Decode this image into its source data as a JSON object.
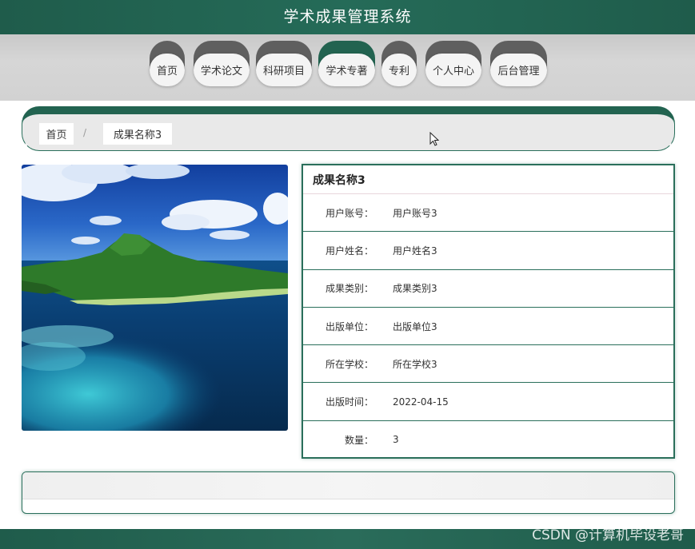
{
  "header": {
    "title": "学术成果管理系统"
  },
  "nav": {
    "items": [
      {
        "label": "首页"
      },
      {
        "label": "学术论文"
      },
      {
        "label": "科研项目"
      },
      {
        "label": "学术专著",
        "active": true
      },
      {
        "label": "专利"
      },
      {
        "label": "个人中心"
      },
      {
        "label": "后台管理"
      }
    ]
  },
  "breadcrumb": {
    "home": "首页",
    "separator": "/",
    "current": "成果名称3"
  },
  "detail": {
    "title": "成果名称3",
    "fields": [
      {
        "label": "用户账号：",
        "value": "用户账号3"
      },
      {
        "label": "用户姓名：",
        "value": "用户姓名3"
      },
      {
        "label": "成果类别：",
        "value": "成果类别3"
      },
      {
        "label": "出版单位：",
        "value": "出版单位3"
      },
      {
        "label": "所在学校：",
        "value": "所在学校3"
      },
      {
        "label": "出版时间：",
        "value": "2022-04-15"
      },
      {
        "label": "数量：",
        "value": "3"
      }
    ]
  },
  "watermark": "CSDN @计算机毕设老哥",
  "colors": {
    "primary": "#226350",
    "nav_inactive": "#5f5f5f",
    "nav_bg": "#d2d2d2"
  }
}
